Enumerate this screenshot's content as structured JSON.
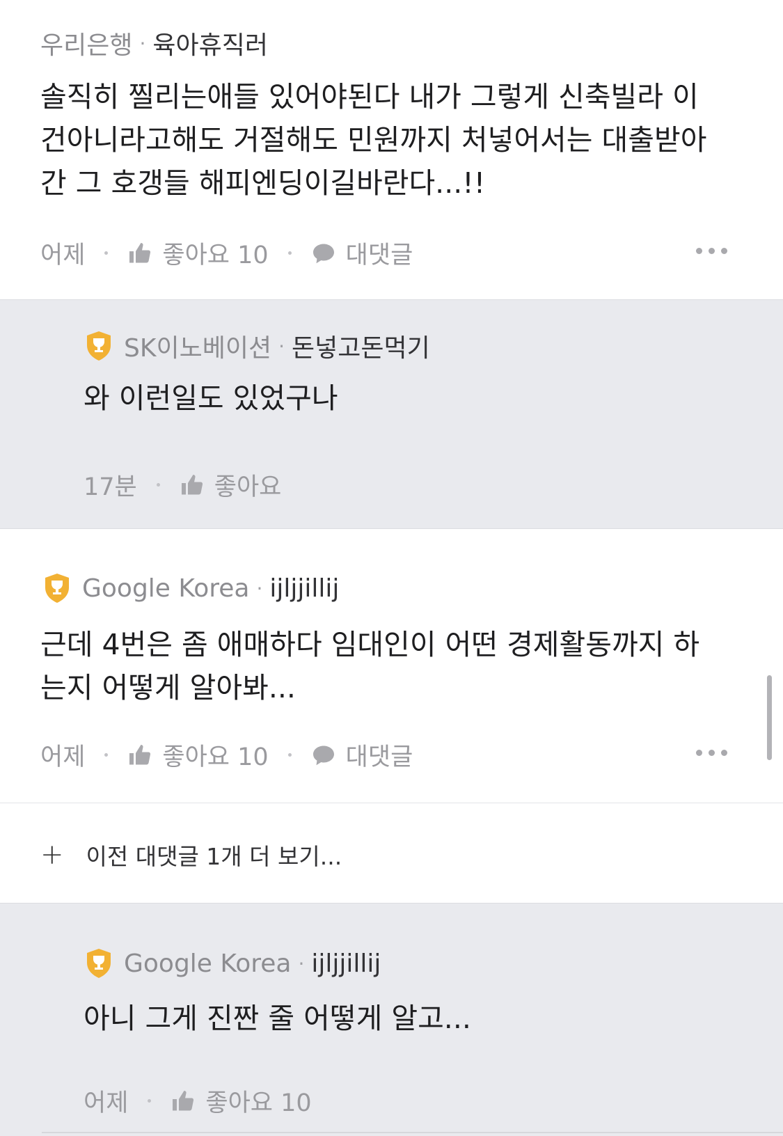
{
  "comments": [
    {
      "company": "우리은행",
      "nickname": "육아휴직러",
      "lines": [
        "솔직히 찔리는애들 있어야된다 내가 그렇게 신축빌라 이",
        "건아니라고해도 거절해도  민원까지 처넣어서는 대출받아",
        "간 그 호갱들 해피엔딩이길바란다...!!"
      ],
      "time": "어제",
      "like_label": "좋아요 10",
      "reply_label": "대댓글"
    },
    {
      "company": "SK이노베이션",
      "nickname": "돈넣고돈먹기",
      "lines": [
        "와 이런일도 있었구나"
      ],
      "time": "17분",
      "like_label": "좋아요"
    },
    {
      "company": "Google Korea",
      "nickname": "ijljjillij",
      "lines": [
        "근데 4번은 좀 애매하다 임대인이 어떤 경제활동까지 하",
        "는지 어떻게 알아봐..."
      ],
      "time": "어제",
      "like_label": "좋아요 10",
      "reply_label": "대댓글"
    },
    {
      "company": "Google Korea",
      "nickname": "ijljjillij",
      "lines": [
        "아니 그게 진짠 줄 어떻게 알고..."
      ],
      "time": "어제",
      "like_label": "좋아요 10"
    }
  ],
  "more_replies_label": "이전 대댓글 1개 더 보기...",
  "colors": {
    "badge": "#f2b133",
    "reply_bg": "#e9eaee"
  },
  "icons": [
    "trophy-badge-icon",
    "thumbs-up-icon",
    "speech-bubble-icon",
    "more-options-icon",
    "plus-icon"
  ]
}
